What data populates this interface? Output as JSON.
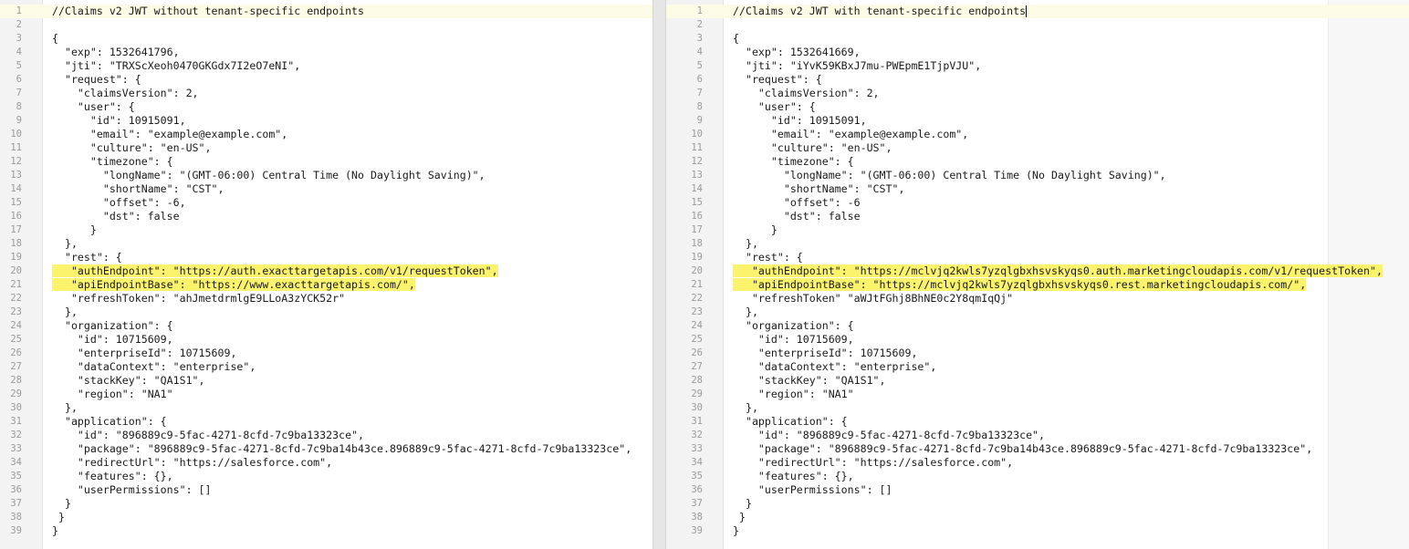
{
  "left_editor": {
    "lines": [
      {
        "n": "1",
        "t": "//Claims v2 JWT without tenant-specific endpoints"
      },
      {
        "n": "2",
        "t": ""
      },
      {
        "n": "3",
        "t": "{"
      },
      {
        "n": "4",
        "t": "  \"exp\": 1532641796,"
      },
      {
        "n": "5",
        "t": "  \"jti\": \"TRXScXeoh0470GKGdx7I2eO7eNI\","
      },
      {
        "n": "6",
        "t": "  \"request\": {"
      },
      {
        "n": "7",
        "t": "    \"claimsVersion\": 2,"
      },
      {
        "n": "8",
        "t": "    \"user\": {"
      },
      {
        "n": "9",
        "t": "      \"id\": 10915091,"
      },
      {
        "n": "10",
        "t": "      \"email\": \"example@example.com\","
      },
      {
        "n": "11",
        "t": "      \"culture\": \"en-US\","
      },
      {
        "n": "12",
        "t": "      \"timezone\": {"
      },
      {
        "n": "13",
        "t": "        \"longName\": \"(GMT-06:00) Central Time (No Daylight Saving)\","
      },
      {
        "n": "14",
        "t": "        \"shortName\": \"CST\","
      },
      {
        "n": "15",
        "t": "        \"offset\": -6,"
      },
      {
        "n": "16",
        "t": "        \"dst\": false"
      },
      {
        "n": "17",
        "t": "      }"
      },
      {
        "n": "18",
        "t": "  },"
      },
      {
        "n": "19",
        "t": "  \"rest\": {"
      },
      {
        "n": "20",
        "t": "   \"authEndpoint\": \"https://auth.exacttargetapis.com/v1/requestToken\",",
        "hl": true
      },
      {
        "n": "21",
        "t": "   \"apiEndpointBase\": \"https://www.exacttargetapis.com/\",",
        "hl": true
      },
      {
        "n": "22",
        "t": "   \"refreshToken\": \"ahJmetdrmlgE9LLoA3zYCK52r\""
      },
      {
        "n": "23",
        "t": "  },"
      },
      {
        "n": "24",
        "t": "  \"organization\": {"
      },
      {
        "n": "25",
        "t": "    \"id\": 10715609,"
      },
      {
        "n": "26",
        "t": "    \"enterpriseId\": 10715609,"
      },
      {
        "n": "27",
        "t": "    \"dataContext\": \"enterprise\","
      },
      {
        "n": "28",
        "t": "    \"stackKey\": \"QA1S1\","
      },
      {
        "n": "29",
        "t": "    \"region\": \"NA1\""
      },
      {
        "n": "30",
        "t": "  },"
      },
      {
        "n": "31",
        "t": "  \"application\": {"
      },
      {
        "n": "32",
        "t": "    \"id\": \"896889c9-5fac-4271-8cfd-7c9ba13323ce\","
      },
      {
        "n": "33",
        "t": "    \"package\": \"896889c9-5fac-4271-8cfd-7c9ba14b43ce.896889c9-5fac-4271-8cfd-7c9ba13323ce\","
      },
      {
        "n": "34",
        "t": "    \"redirectUrl\": \"https://salesforce.com\","
      },
      {
        "n": "35",
        "t": "    \"features\": {},"
      },
      {
        "n": "36",
        "t": "    \"userPermissions\": []"
      },
      {
        "n": "37",
        "t": "  }"
      },
      {
        "n": "38",
        "t": " }"
      },
      {
        "n": "39",
        "t": "}"
      }
    ]
  },
  "right_editor": {
    "lines": [
      {
        "n": "1",
        "t": "//Claims v2 JWT with tenant-specific endpoints"
      },
      {
        "n": "2",
        "t": ""
      },
      {
        "n": "3",
        "t": "{"
      },
      {
        "n": "4",
        "t": "  \"exp\": 1532641669,"
      },
      {
        "n": "5",
        "t": "  \"jti\": \"iYvK59KBxJ7mu-PWEpmE1TjpVJU\","
      },
      {
        "n": "6",
        "t": "  \"request\": {"
      },
      {
        "n": "7",
        "t": "    \"claimsVersion\": 2,"
      },
      {
        "n": "8",
        "t": "    \"user\": {"
      },
      {
        "n": "9",
        "t": "      \"id\": 10915091,"
      },
      {
        "n": "10",
        "t": "      \"email\": \"example@example.com\","
      },
      {
        "n": "11",
        "t": "      \"culture\": \"en-US\","
      },
      {
        "n": "12",
        "t": "      \"timezone\": {"
      },
      {
        "n": "13",
        "t": "        \"longName\": \"(GMT-06:00) Central Time (No Daylight Saving)\","
      },
      {
        "n": "14",
        "t": "        \"shortName\": \"CST\","
      },
      {
        "n": "15",
        "t": "        \"offset\": -6"
      },
      {
        "n": "16",
        "t": "        \"dst\": false"
      },
      {
        "n": "17",
        "t": "      }"
      },
      {
        "n": "18",
        "t": "  },"
      },
      {
        "n": "19",
        "t": "  \"rest\": {"
      },
      {
        "n": "20",
        "t": "   \"authEndpoint\": \"https://mclvjq2kwls7yzqlgbxhsvskyqs0.auth.marketingcloudapis.com/v1/requestToken\",",
        "hl": true
      },
      {
        "n": "21",
        "t": "   \"apiEndpointBase\": \"https://mclvjq2kwls7yzqlgbxhsvskyqs0.rest.marketingcloudapis.com/\",",
        "hl": true
      },
      {
        "n": "22",
        "t": "   \"refreshToken\" \"aWJtFGhj8BhNE0c2Y8qmIqQj\""
      },
      {
        "n": "23",
        "t": "  },"
      },
      {
        "n": "24",
        "t": "  \"organization\": {"
      },
      {
        "n": "25",
        "t": "    \"id\": 10715609,"
      },
      {
        "n": "26",
        "t": "    \"enterpriseId\": 10715609,"
      },
      {
        "n": "27",
        "t": "    \"dataContext\": \"enterprise\","
      },
      {
        "n": "28",
        "t": "    \"stackKey\": \"QA1S1\","
      },
      {
        "n": "29",
        "t": "    \"region\": \"NA1\""
      },
      {
        "n": "30",
        "t": "  },"
      },
      {
        "n": "31",
        "t": "  \"application\": {"
      },
      {
        "n": "32",
        "t": "    \"id\": \"896889c9-5fac-4271-8cfd-7c9ba13323ce\","
      },
      {
        "n": "33",
        "t": "    \"package\": \"896889c9-5fac-4271-8cfd-7c9ba14b43ce.896889c9-5fac-4271-8cfd-7c9ba13323ce\","
      },
      {
        "n": "34",
        "t": "    \"redirectUrl\": \"https://salesforce.com\","
      },
      {
        "n": "35",
        "t": "    \"features\": {},"
      },
      {
        "n": "36",
        "t": "    \"userPermissions\": []"
      },
      {
        "n": "37",
        "t": "  }"
      },
      {
        "n": "38",
        "t": " }"
      },
      {
        "n": "39",
        "t": "}"
      }
    ]
  },
  "colors": {
    "highlight": "#fbf36b",
    "gutter_bg": "#f3f3f3",
    "line_number": "#9a9a9a",
    "separator": "#e6e6e6"
  }
}
